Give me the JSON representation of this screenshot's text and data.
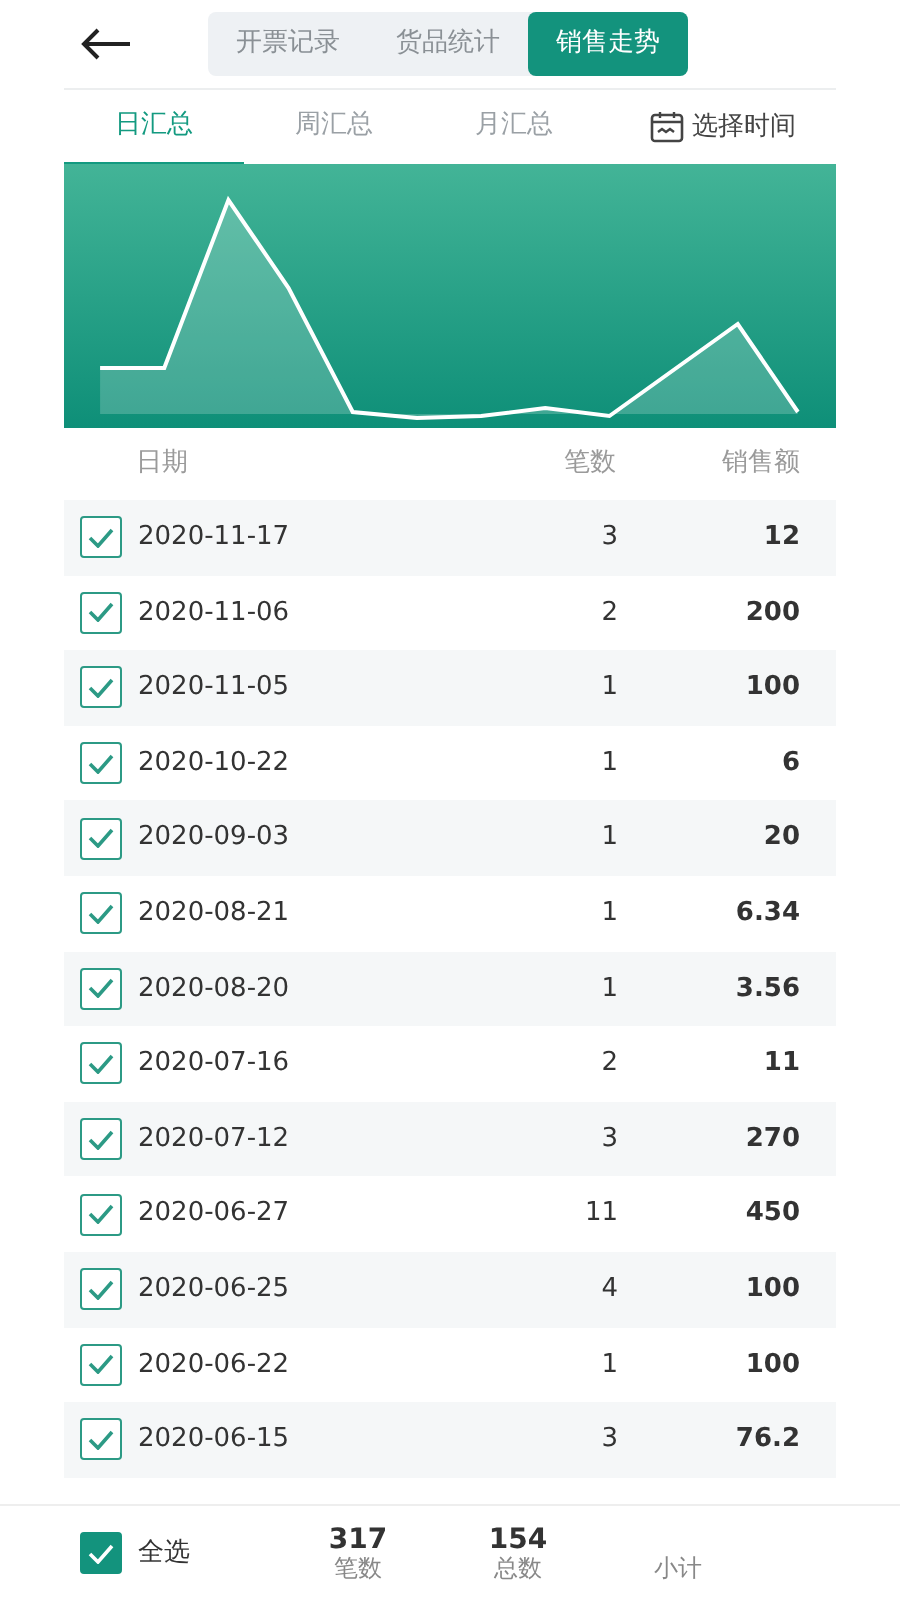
{
  "top_tabs": [
    {
      "label": "开票记录",
      "selected": false
    },
    {
      "label": "货品统计",
      "selected": false
    },
    {
      "label": "销售走势",
      "selected": true
    }
  ],
  "sub_tabs": [
    {
      "label": "日汇总",
      "selected": true
    },
    {
      "label": "周汇总",
      "selected": false
    },
    {
      "label": "月汇总",
      "selected": false
    }
  ],
  "date_picker": {
    "label": "选择时间"
  },
  "table": {
    "columns": [
      "日期",
      "笔数",
      "销售额"
    ],
    "rows": [
      {
        "date": "2020-11-17",
        "count": "3",
        "amount": "12",
        "checked": true
      },
      {
        "date": "2020-11-06",
        "count": "2",
        "amount": "200",
        "checked": true
      },
      {
        "date": "2020-11-05",
        "count": "1",
        "amount": "100",
        "checked": true
      },
      {
        "date": "2020-10-22",
        "count": "1",
        "amount": "6",
        "checked": true
      },
      {
        "date": "2020-09-03",
        "count": "1",
        "amount": "20",
        "checked": true
      },
      {
        "date": "2020-08-21",
        "count": "1",
        "amount": "6.34",
        "checked": true
      },
      {
        "date": "2020-08-20",
        "count": "1",
        "amount": "3.56",
        "checked": true
      },
      {
        "date": "2020-07-16",
        "count": "2",
        "amount": "11",
        "checked": true
      },
      {
        "date": "2020-07-12",
        "count": "3",
        "amount": "270",
        "checked": true
      },
      {
        "date": "2020-06-27",
        "count": "11",
        "amount": "450",
        "checked": true
      },
      {
        "date": "2020-06-25",
        "count": "4",
        "amount": "100",
        "checked": true
      },
      {
        "date": "2020-06-22",
        "count": "1",
        "amount": "100",
        "checked": true
      },
      {
        "date": "2020-06-15",
        "count": "3",
        "amount": "76.2",
        "checked": true
      }
    ]
  },
  "footer": {
    "select_all": {
      "label": "全选",
      "checked": true
    },
    "stats": [
      {
        "value": "317",
        "label": "笔数"
      },
      {
        "value": "154",
        "label": "总数"
      },
      {
        "label": "小计"
      }
    ]
  }
}
